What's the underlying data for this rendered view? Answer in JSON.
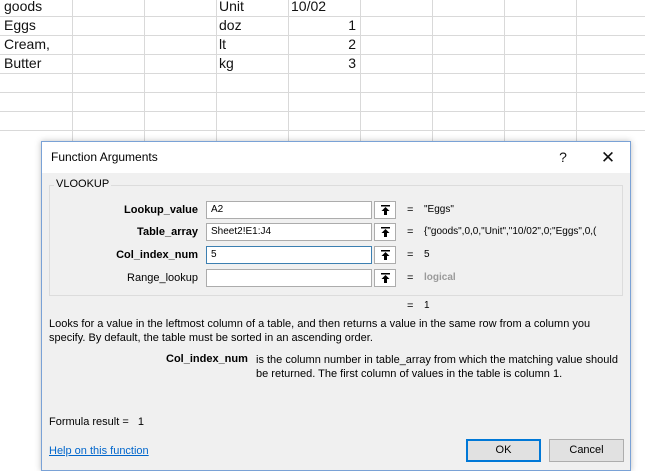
{
  "sheet": {
    "rows": [
      {
        "a": "goods",
        "c": "Unit",
        "d": "10/02"
      },
      {
        "a": "Eggs",
        "c": "doz",
        "d": "1"
      },
      {
        "a": "Cream,",
        "c": "lt",
        "d": "2"
      },
      {
        "a": "Butter",
        "c": "kg",
        "d": "3"
      }
    ]
  },
  "dialog": {
    "title": "Function Arguments",
    "help_glyph": "?",
    "close_glyph": "✕",
    "function_name": "VLOOKUP",
    "args": [
      {
        "label": "Lookup_value",
        "value": "A2",
        "result": "\"Eggs\""
      },
      {
        "label": "Table_array",
        "value": "Sheet2!E1:J4",
        "result": "{\"goods\",0,0,\"Unit\",\"10/02\",0;\"Eggs\",0,("
      },
      {
        "label": "Col_index_num",
        "value": "5",
        "result": "5"
      },
      {
        "label": "Range_lookup",
        "value": "",
        "result": "logical"
      }
    ],
    "eq": "=",
    "overall_result": "1",
    "description": "Looks for a value in the leftmost column of a table, and then returns a value in the same row from a column you specify. By default, the table must be sorted in an ascending order.",
    "param_name": "Col_index_num",
    "param_description": "is the column number in table_array from which the matching value should be returned. The first column of values in the table is column 1.",
    "formula_result_label": "Formula result =",
    "formula_result_value": "1",
    "help_link": "Help on this function",
    "ok_label": "OK",
    "cancel_label": "Cancel"
  }
}
